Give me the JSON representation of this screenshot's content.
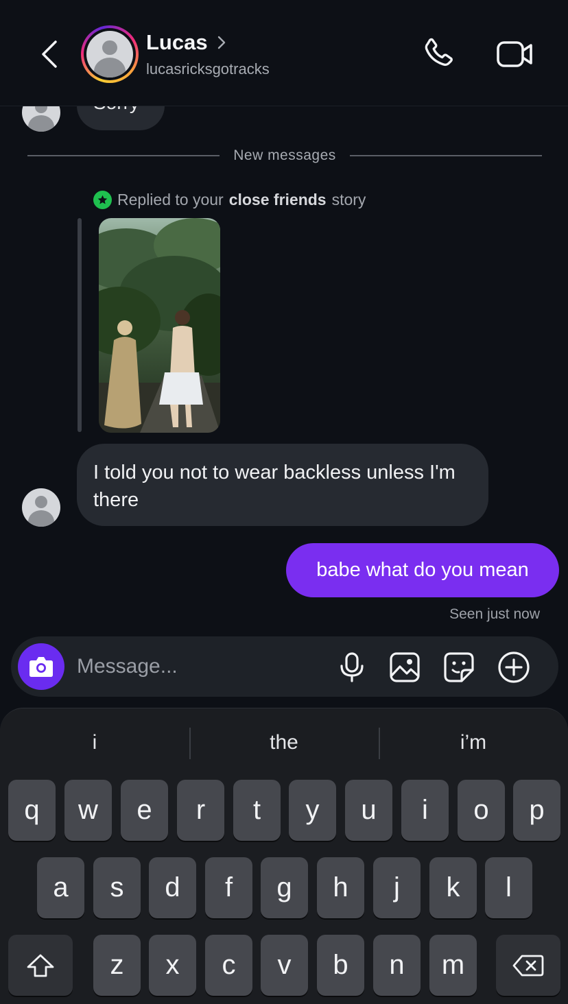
{
  "header": {
    "contact_name": "Lucas",
    "contact_handle": "lucasricksgotracks"
  },
  "chat": {
    "previous_message": "Sorry",
    "divider_label": "New messages",
    "reply_note": {
      "prefix": "Replied to your",
      "emphasis": "close friends",
      "suffix": "story"
    },
    "incoming_message": "I told you not to wear backless unless I'm there",
    "outgoing_message": "babe what do you mean",
    "seen_status": "Seen just now"
  },
  "composer": {
    "placeholder": "Message..."
  },
  "keyboard": {
    "suggestions": [
      "i",
      "the",
      "i’m"
    ],
    "row1": [
      "q",
      "w",
      "e",
      "r",
      "t",
      "y",
      "u",
      "i",
      "o",
      "p"
    ],
    "row2": [
      "a",
      "s",
      "d",
      "f",
      "g",
      "h",
      "j",
      "k",
      "l"
    ],
    "row3": [
      "z",
      "x",
      "c",
      "v",
      "b",
      "n",
      "m"
    ]
  },
  "colors": {
    "outgoing_bubble": "#7a2ef0",
    "incoming_bubble": "#262a31",
    "camera_button": "#6a2cf0",
    "close_friends_badge": "#1fc04f"
  },
  "icons": {
    "back": "chevron-left-icon",
    "call": "phone-icon",
    "video": "video-camera-icon",
    "camera": "camera-icon",
    "mic": "microphone-icon",
    "gallery": "image-icon",
    "sticker": "sticker-icon",
    "more": "plus-circle-icon",
    "shift": "shift-icon",
    "delete": "backspace-icon"
  }
}
